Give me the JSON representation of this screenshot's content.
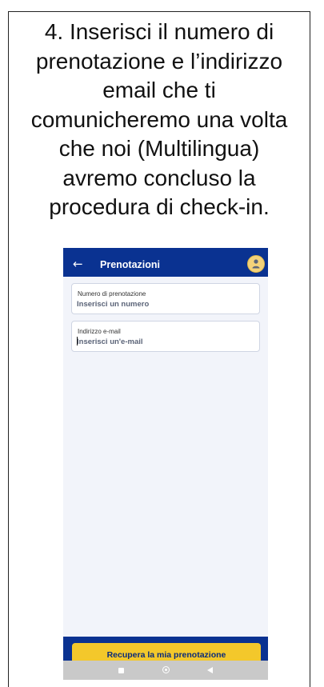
{
  "instruction": {
    "line1": "4. Inserisci il numero di",
    "line2": "prenotazione e l’indirizzo",
    "line3": "email che ti",
    "line4": "comunicheremo una volta",
    "line5": "che noi (Multilingua)",
    "line6": "avremo concluso la",
    "line7": "procedura di check-in."
  },
  "appbar": {
    "back_icon": "←",
    "title": "Prenotazioni",
    "avatar_icon": "user-avatar"
  },
  "form": {
    "booking": {
      "label": "Numero di prenotazione",
      "placeholder": "Inserisci un numero",
      "value": ""
    },
    "email": {
      "label": "Indirizzo e-mail",
      "placeholder": "Inserisci un'e-mail",
      "value": ""
    }
  },
  "actions": {
    "submit_label": "Recupera la mia prenotazione"
  },
  "colors": {
    "primary": "#0a3291",
    "accent": "#f3c82b",
    "background": "#f2f4fa"
  },
  "system_nav": {
    "icons": [
      "recents-square-icon",
      "home-circle-icon",
      "back-triangle-icon"
    ]
  }
}
